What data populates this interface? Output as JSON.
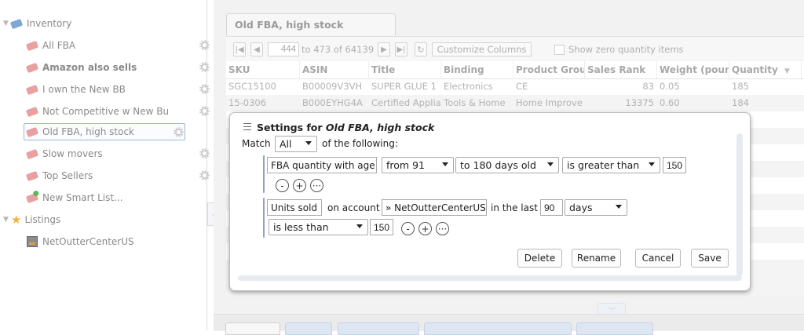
{
  "sidebar": {
    "items": [
      {
        "label": "Inventory",
        "icon": "folder-tag-icon"
      },
      {
        "label": "All FBA"
      },
      {
        "label": "Amazon also sells"
      },
      {
        "label": "I own the New BB"
      },
      {
        "label": "Not Competitive w New Bu"
      },
      {
        "label": "Old FBA, high stock"
      },
      {
        "label": "Slow movers"
      },
      {
        "label": "Top Sellers"
      },
      {
        "label": "New Smart List..."
      },
      {
        "label": "Listings"
      },
      {
        "label": "NetOutterCenterUS"
      }
    ]
  },
  "tab": {
    "label": "Old FBA, high stock"
  },
  "toolbar": {
    "page_value": "444",
    "range_text": "to 473 of 64139",
    "customize_label": "Customize Columns",
    "show_zero_label": "Show zero quantity items"
  },
  "grid": {
    "columns": [
      "SKU",
      "ASIN",
      "Title",
      "Binding",
      "Product Grou",
      "Sales Rank",
      "Weight (poun",
      "Quantity"
    ],
    "rows": [
      [
        "SGC15100",
        "B00009V3VH",
        "SUPER GLUE 1",
        "Electronics",
        "CE",
        "83",
        "0.05",
        "185"
      ],
      [
        "15-0306",
        "B000EYHG4A",
        "Certified Applia",
        "Tools & Home",
        "Home Improve",
        "13375",
        "0.60",
        "184"
      ]
    ]
  },
  "dialog": {
    "title_prefix": "Settings for ",
    "title_list": "Old FBA, high stock",
    "match_label": "Match",
    "match_value": "All",
    "of_following": "of the following:",
    "rule1": {
      "field": "FBA quantity with age",
      "from": "from 91",
      "to": "to 180 days old",
      "op": "is greater than",
      "value": "150"
    },
    "rule2": {
      "field": "Units sold",
      "on_account": "on account",
      "account": "» NetOutterCenterUS",
      "in_last": "in the last",
      "days_value": "90",
      "unit": "days",
      "op": "is less than",
      "value": "150"
    },
    "buttons": {
      "delete": "Delete",
      "rename": "Rename",
      "cancel": "Cancel",
      "save": "Save"
    }
  }
}
